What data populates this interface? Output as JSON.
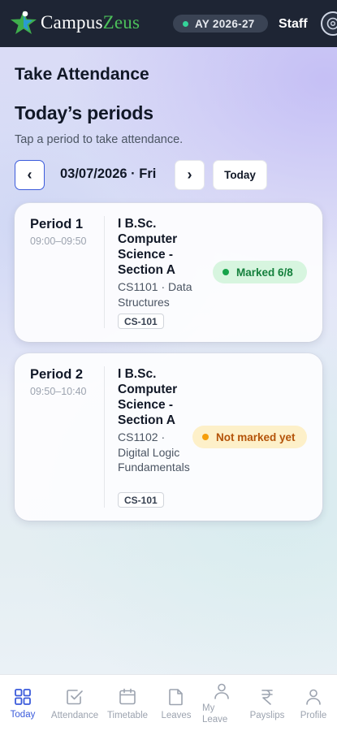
{
  "app": {
    "brand_part1": "Campus",
    "brand_part2": "Zeus",
    "academic_year": "AY 2026-27",
    "role": "Staff"
  },
  "page": {
    "title": "Take Attendance",
    "section_title": "Today’s periods",
    "section_subtitle": "Tap a period to take attendance."
  },
  "date_nav": {
    "prev_symbol": "‹",
    "next_symbol": "›",
    "current_date": "03/07/2026 · Fri",
    "today_label": "Today"
  },
  "periods": [
    {
      "name": "Period 1",
      "time": "09:00–09:50",
      "class_name": "I B.Sc. Computer Science - Section A",
      "course": "CS1101 · Data Structures",
      "room": "CS-101",
      "status": "Marked 6/8"
    },
    {
      "name": "Period 2",
      "time": "09:50–10:40",
      "class_name": "I B.Sc. Computer Science - Section A",
      "course": "CS1102 · Digital Logic Fundamentals",
      "room": "CS-101",
      "status": "Not marked yet"
    }
  ],
  "bottom_nav": [
    {
      "label": "Today",
      "icon": "grid-icon",
      "active": true
    },
    {
      "label": "Attendance",
      "icon": "checkbox-icon",
      "active": false
    },
    {
      "label": "Timetable",
      "icon": "calendar-icon",
      "active": false
    },
    {
      "label": "Leaves",
      "icon": "document-icon",
      "active": false
    },
    {
      "label": "My Leave",
      "icon": "person-icon",
      "active": false
    },
    {
      "label": "Payslips",
      "icon": "rupee-icon",
      "active": false
    },
    {
      "label": "Profile",
      "icon": "person-icon",
      "active": false
    }
  ],
  "colors": {
    "header_bg": "#1e2534",
    "accent": "#3b5bdb",
    "brand_green": "#4cc05a",
    "status_marked": "#16a34a",
    "status_pending": "#f59e0b"
  }
}
